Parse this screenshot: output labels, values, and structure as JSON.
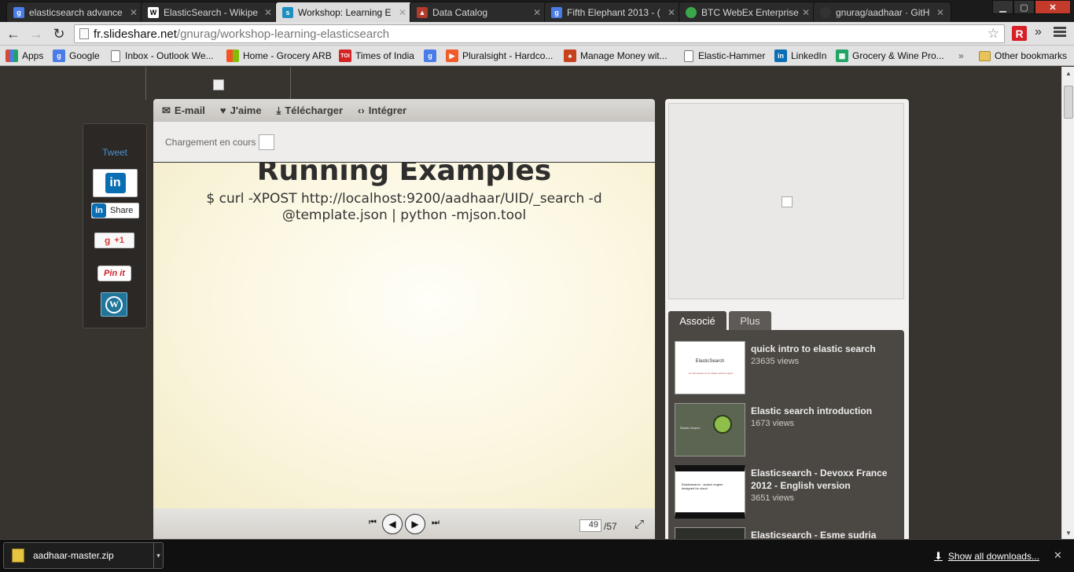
{
  "browser": {
    "tabs": [
      {
        "title": "elasticsearch advance",
        "favicon": "google-icon",
        "color": "#4a7ce8"
      },
      {
        "title": "ElasticSearch - Wikipe",
        "favicon": "wikipedia-icon",
        "color": "#ffffff"
      },
      {
        "title": "Workshop: Learning E",
        "favicon": "slideshare-icon",
        "color": "#1f8fc2",
        "active": true
      },
      {
        "title": "Data Catalog",
        "favicon": "datacatalog-icon",
        "color": "#b23b2b"
      },
      {
        "title": "Fifth Elephant 2013 - (",
        "favicon": "google-icon",
        "color": "#4a7ce8"
      },
      {
        "title": "BTC WebEx Enterprise",
        "favicon": "webex-globe-icon",
        "color": "#3aa84a"
      },
      {
        "title": "gnurag/aadhaar · GitH",
        "favicon": "github-icon",
        "color": "#333333"
      }
    ],
    "window_controls": {
      "minimize": "▁",
      "maximize": "▢",
      "close": "✕"
    },
    "nav": {
      "back": "←",
      "forward": "→",
      "reload": "↻"
    },
    "url_host": "fr.slideshare.net",
    "url_path": "/gnurag/workshop-learning-elasticsearch",
    "extension_label": "R",
    "overflow": "»",
    "bookmarks": [
      {
        "label": "Apps",
        "icon": "apps-grid-icon",
        "color": "#d44a3a"
      },
      {
        "label": "Google",
        "icon": "google-icon",
        "color": "#4a7ce8"
      },
      {
        "label": "Inbox - Outlook We...",
        "icon": "page-icon",
        "color": ""
      },
      {
        "label": "Home - Grocery ARB",
        "icon": "windows-icon",
        "color": "#f35325"
      },
      {
        "label": "Times of India",
        "icon": "toi-icon",
        "color": "#d32323"
      },
      {
        "label": "",
        "icon": "google-icon",
        "color": "#4a7ce8"
      },
      {
        "label": "Pluralsight - Hardco...",
        "icon": "pluralsight-icon",
        "color": "#f15b2a"
      },
      {
        "label": "Manage Money wit...",
        "icon": "mint-icon",
        "color": "#c6421e"
      },
      {
        "label": "Elastic-Hammer",
        "icon": "page-icon",
        "color": ""
      },
      {
        "label": "LinkedIn",
        "icon": "linkedin-icon",
        "color": "#0a6eb4"
      },
      {
        "label": "Grocery & Wine Pro...",
        "icon": "sheets-icon",
        "color": "#1fa463"
      }
    ],
    "other_bookmarks": "Other bookmarks"
  },
  "share": {
    "tweet": "Tweet",
    "linkedin_share": "Share",
    "gplus": "+1",
    "pinit": "Pin it",
    "wordpress": "W"
  },
  "player": {
    "toolbar": {
      "email": "E-mail",
      "like": "J'aime",
      "download": "Télécharger",
      "embed": "Intégrer"
    },
    "loading": "Chargement en cours",
    "slide_title": "Running Examples",
    "slide_code": "$ curl -XPOST http://localhost:9200/aadhaar/UID/_search -d @template.json | python -mjson.tool",
    "current_page": "49",
    "total_pages": "/57"
  },
  "related": {
    "tab_active": "Associé",
    "tab_more": "Plus",
    "items": [
      {
        "title": "quick intro to elastic search",
        "views": "23635 views",
        "thumb_title": "ElasticSearch",
        "thumb_sub": "An introduction to an elastic search engine"
      },
      {
        "title": "Elastic search introduction",
        "views": "1673 views",
        "thumb_title": "Elastic Search",
        "thumb_sub": ""
      },
      {
        "title": "Elasticsearch - Devoxx France 2012 - English version",
        "views": "3651 views",
        "thumb_title": "Elasticsearch - search engine designed for cloud",
        "thumb_sub": ""
      },
      {
        "title": "Elasticsearch - Esme sudria",
        "views": "",
        "thumb_title": "",
        "thumb_sub": ""
      }
    ]
  },
  "downloads": {
    "file": "aadhaar-master.zip",
    "show_all": "Show all downloads...",
    "close": "✕"
  }
}
